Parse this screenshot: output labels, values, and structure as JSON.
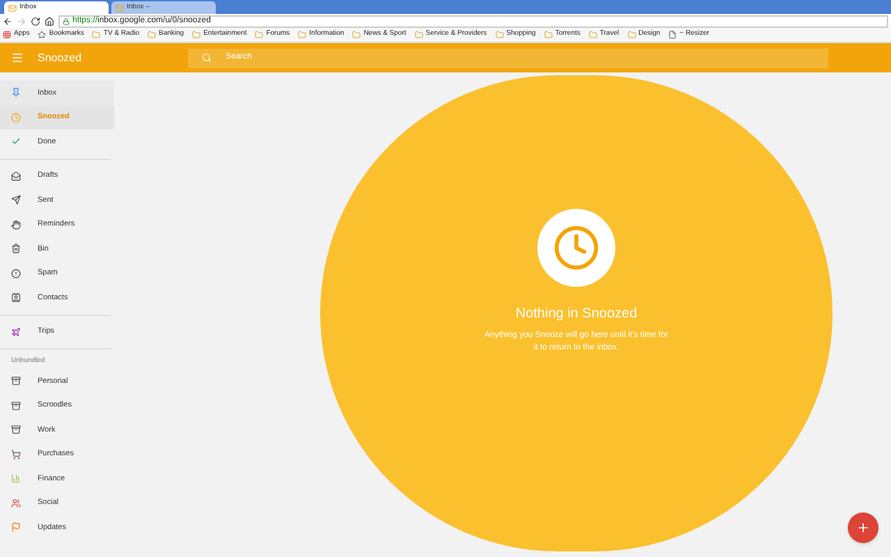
{
  "browser": {
    "tabs": [
      {
        "label": "Inbox",
        "selected": true
      },
      {
        "label": "Inbox –",
        "selected": false
      }
    ],
    "url": {
      "scheme": "https://",
      "rest": "inbox.google.com/u/0/snoozed"
    },
    "bookmarks": [
      {
        "label": "Apps",
        "kind": "apps"
      },
      {
        "label": "Bookmarks",
        "kind": "star"
      },
      {
        "label": "TV & Radio",
        "kind": "folder"
      },
      {
        "label": "Banking",
        "kind": "folder"
      },
      {
        "label": "Entertainment",
        "kind": "folder"
      },
      {
        "label": "Forums",
        "kind": "folder"
      },
      {
        "label": "Information",
        "kind": "folder"
      },
      {
        "label": "News & Sport",
        "kind": "folder"
      },
      {
        "label": "Service & Providers",
        "kind": "folder"
      },
      {
        "label": "Shopping",
        "kind": "folder"
      },
      {
        "label": "Torrents",
        "kind": "folder"
      },
      {
        "label": "Travel",
        "kind": "folder"
      },
      {
        "label": "Design",
        "kind": "folder"
      },
      {
        "label": "~ Resizer",
        "kind": "page"
      }
    ]
  },
  "app_bar": {
    "title": "Snoozed",
    "search": {
      "placeholder": "Search"
    }
  },
  "sidebar": {
    "groups": [
      {
        "items": [
          {
            "label": "Inbox",
            "kind": "pin",
            "selected": false
          },
          {
            "label": "Snoozed",
            "kind": "clock",
            "selected": true
          },
          {
            "label": "Done",
            "kind": "check",
            "selected": false
          }
        ]
      },
      {
        "items": [
          {
            "label": "Drafts",
            "kind": "drafts",
            "selected": false
          },
          {
            "label": "Sent",
            "kind": "send",
            "selected": false
          },
          {
            "label": "Reminders",
            "kind": "hand",
            "selected": false
          },
          {
            "label": "Bin",
            "kind": "trash",
            "selected": false
          },
          {
            "label": "Spam",
            "kind": "alert",
            "selected": false
          },
          {
            "label": "Contacts",
            "kind": "contact",
            "selected": false
          }
        ]
      },
      {
        "items": [
          {
            "label": "Trips",
            "kind": "plane",
            "selected": false
          }
        ]
      },
      {
        "heading": "Unbundled",
        "items": [
          {
            "label": "Personal",
            "kind": "bundle",
            "selected": false
          },
          {
            "label": "Scroodles",
            "kind": "bundle",
            "selected": false
          },
          {
            "label": "Work",
            "kind": "bundle",
            "selected": false
          },
          {
            "label": "Purchases",
            "kind": "cart",
            "selected": false
          },
          {
            "label": "Finance",
            "kind": "chart",
            "selected": false
          },
          {
            "label": "Social",
            "kind": "people",
            "selected": false
          },
          {
            "label": "Updates",
            "kind": "flag",
            "selected": false
          }
        ]
      }
    ]
  },
  "empty_state": {
    "title": "Nothing in Snoozed",
    "message": "Anything you Snooze will go here until it's time for it to return to the inbox."
  }
}
